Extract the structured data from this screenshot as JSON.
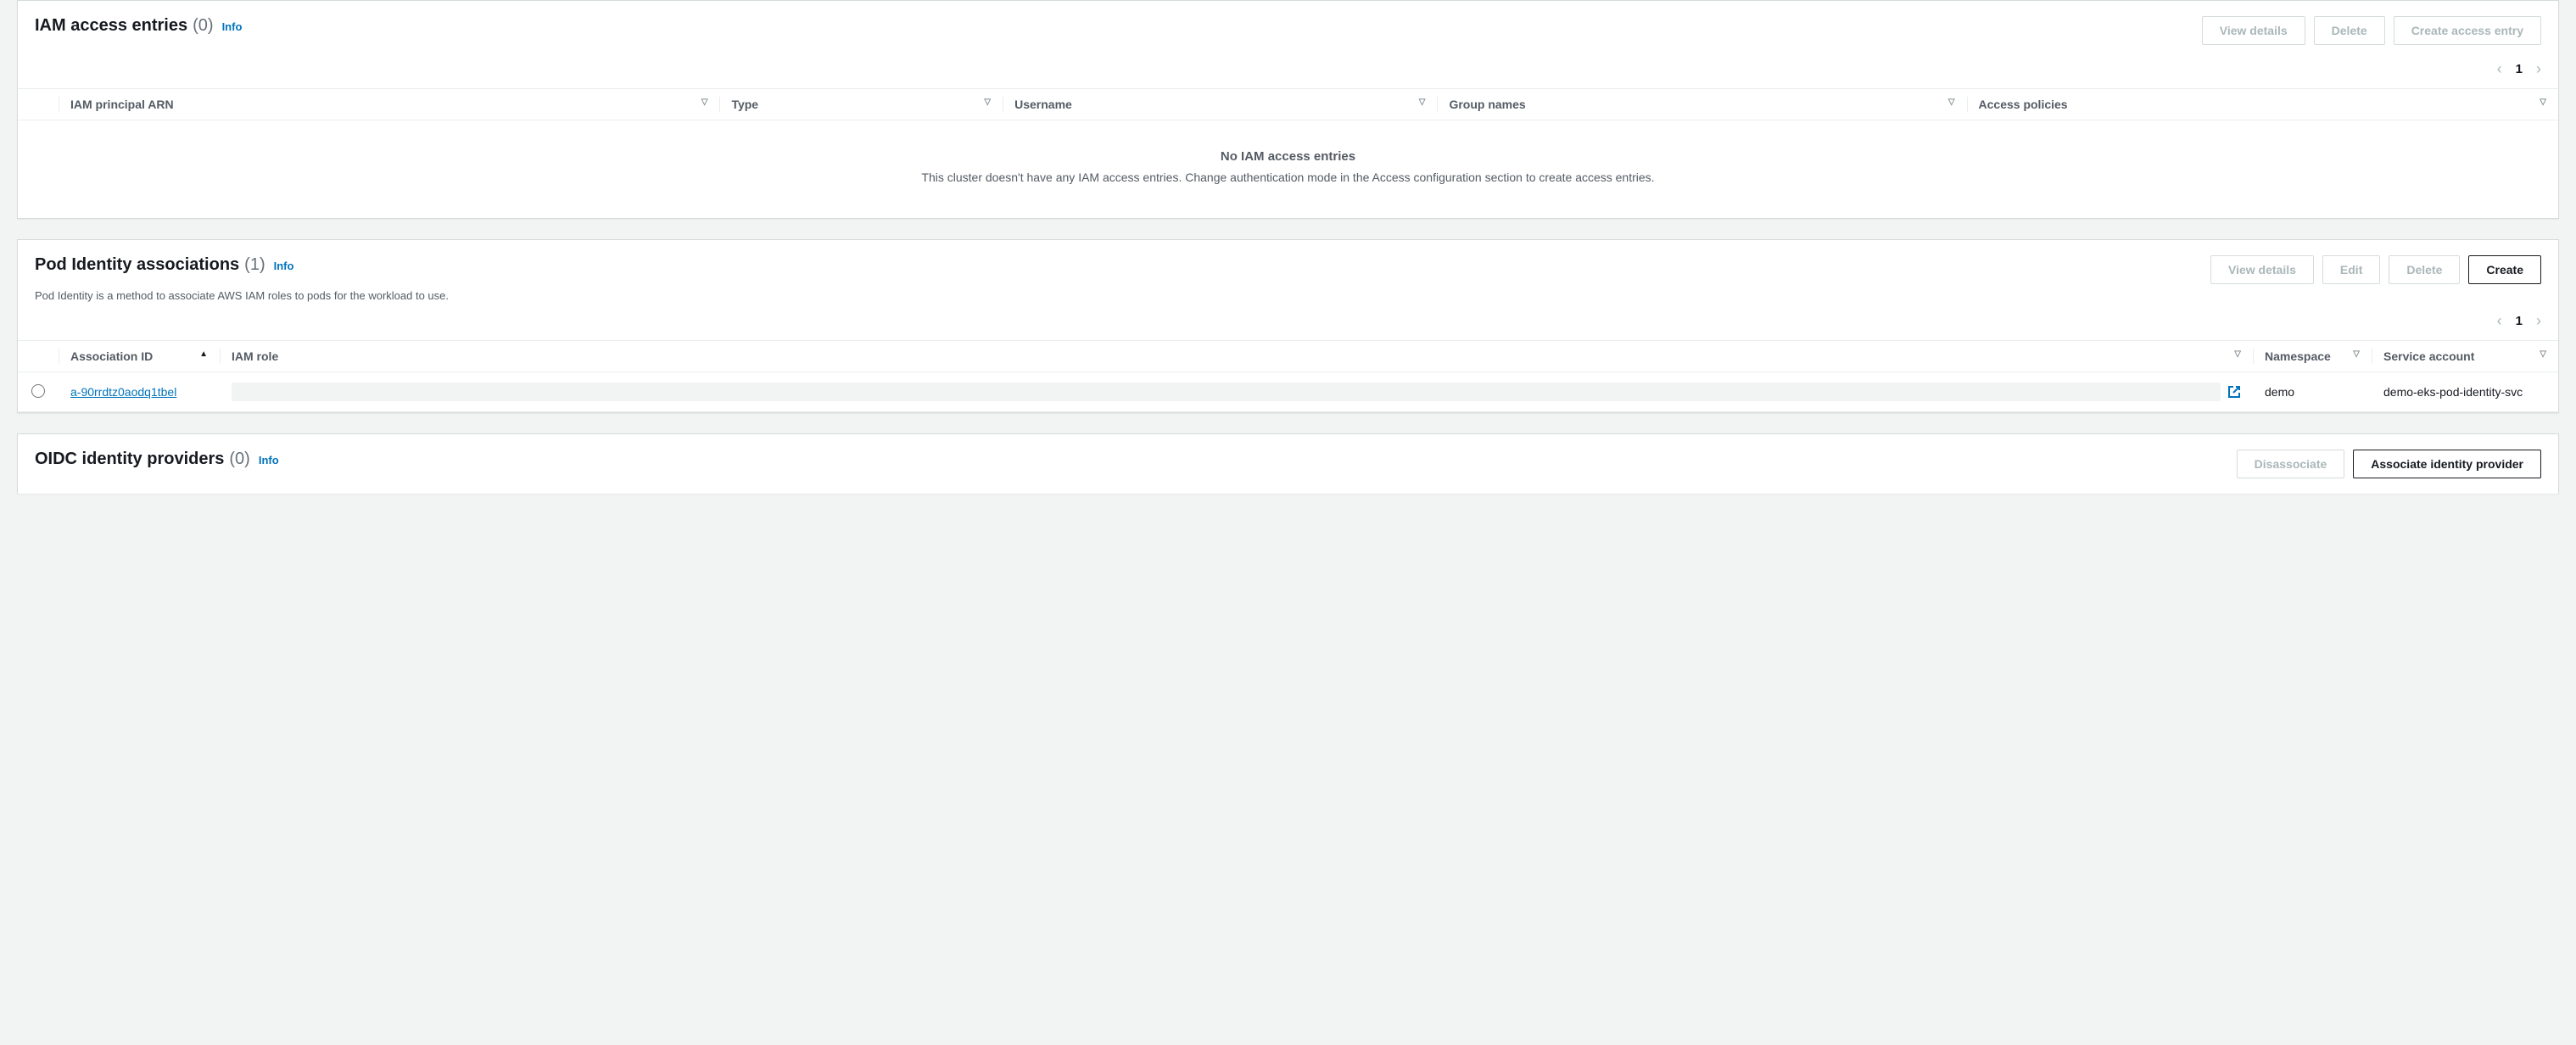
{
  "iam": {
    "title": "IAM access entries",
    "count": "(0)",
    "info": "Info",
    "buttons": {
      "view": "View details",
      "delete": "Delete",
      "create": "Create access entry"
    },
    "page": "1",
    "columns": {
      "arn": "IAM principal ARN",
      "type": "Type",
      "username": "Username",
      "groups": "Group names",
      "policies": "Access policies"
    },
    "empty_title": "No IAM access entries",
    "empty_desc": "This cluster doesn't have any IAM access entries. Change authentication mode in the Access configuration section to create access entries."
  },
  "pod": {
    "title": "Pod Identity associations",
    "count": "(1)",
    "info": "Info",
    "desc": "Pod Identity is a method to associate AWS IAM roles to pods for the workload to use.",
    "buttons": {
      "view": "View details",
      "edit": "Edit",
      "delete": "Delete",
      "create": "Create"
    },
    "page": "1",
    "columns": {
      "assoc": "Association ID",
      "role": "IAM role",
      "ns": "Namespace",
      "svc": "Service account"
    },
    "row": {
      "assoc_id": "a-90rrdtz0aodq1tbel",
      "namespace": "demo",
      "service_account": "demo-eks-pod-identity-svc"
    }
  },
  "oidc": {
    "title": "OIDC identity providers",
    "count": "(0)",
    "info": "Info",
    "buttons": {
      "disassociate": "Disassociate",
      "associate": "Associate identity provider"
    }
  }
}
